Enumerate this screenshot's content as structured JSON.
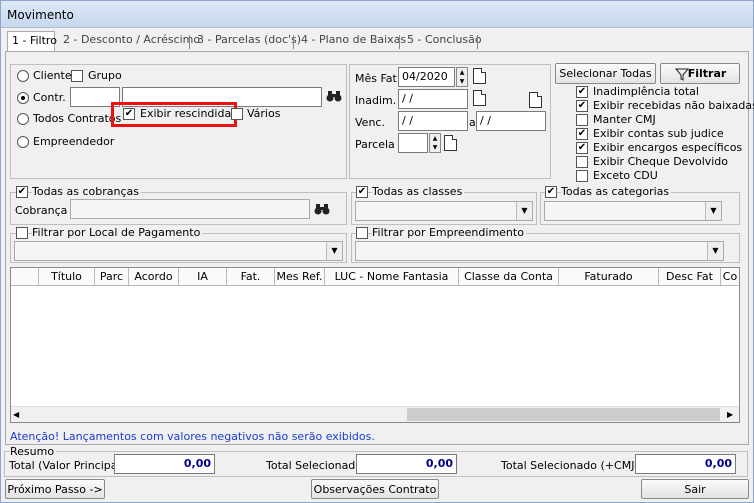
{
  "window": {
    "title": "Movimento"
  },
  "tabs": [
    {
      "label": "1 - Filtro"
    },
    {
      "label": "2 - Desconto / Acréscimo"
    },
    {
      "label": "3 - Parcelas (doc's)"
    },
    {
      "label": "4 - Plano de Baixas"
    },
    {
      "label": "5 - Conclusão"
    }
  ],
  "entity": {
    "cliente": "Cliente",
    "grupo": "Grupo",
    "contr": "Contr.",
    "todos": "Todos Contratos",
    "empreendedor": "Empreendedor",
    "exibir_rescindidas": "Exibir rescindidas",
    "varios": "Vários",
    "selected": "contr"
  },
  "dates": {
    "mes_fat_label": "Mês Fat.",
    "mes_fat_value": "04/2020",
    "inadim_label": "Inadim.",
    "inadim_value": " /  /",
    "venc_label": "Venc.",
    "venc_from": " /  /",
    "venc_a": "a",
    "venc_to": " /  /",
    "parcela_label": "Parcela",
    "parcela_value": ""
  },
  "buttons": {
    "selecionar_todas": "Selecionar Todas",
    "filtrar": "Filtrar",
    "proximo": "Próximo Passo ->",
    "observacoes": "Observações Contrato",
    "sair": "Sair"
  },
  "options": [
    {
      "label": "Inadimplência total",
      "checked": true
    },
    {
      "label": "Exibir recebidas não baixadas",
      "checked": true
    },
    {
      "label": "Manter CMJ",
      "checked": false
    },
    {
      "label": "Exibir contas sub judice",
      "checked": true
    },
    {
      "label": "Exibir encargos específicos",
      "checked": true
    },
    {
      "label": "Exibir Cheque Devolvido",
      "checked": false
    },
    {
      "label": "Exceto CDU",
      "checked": false
    }
  ],
  "filters": {
    "todas_cobrancas": "Todas as cobranças",
    "cobranca_label": "Cobrança",
    "todas_classes": "Todas as classes",
    "todas_categorias": "Todas as categorias",
    "local_pagamento": "Filtrar por Local de Pagamento",
    "empreendimento": "Filtrar por Empreendimento"
  },
  "grid": {
    "columns": [
      "Título",
      "Parc",
      "Acordo",
      "IA",
      "Fat.",
      "Mes Ref.",
      "LUC - Nome Fantasia",
      "Classe da Conta",
      "Faturado",
      "Desc Fat",
      "Co"
    ]
  },
  "warning": "Atenção! Lançamentos com valores negativos não serão exibidos.",
  "resumo": {
    "title": "Resumo",
    "total_label": "Total (Valor Principal)",
    "total_value": "0,00",
    "sel_label": "Total Selecionado",
    "sel_value": "0,00",
    "selcmjd_label": "Total Selecionado (+CMJD)",
    "selcmjd_value": "0,00"
  }
}
